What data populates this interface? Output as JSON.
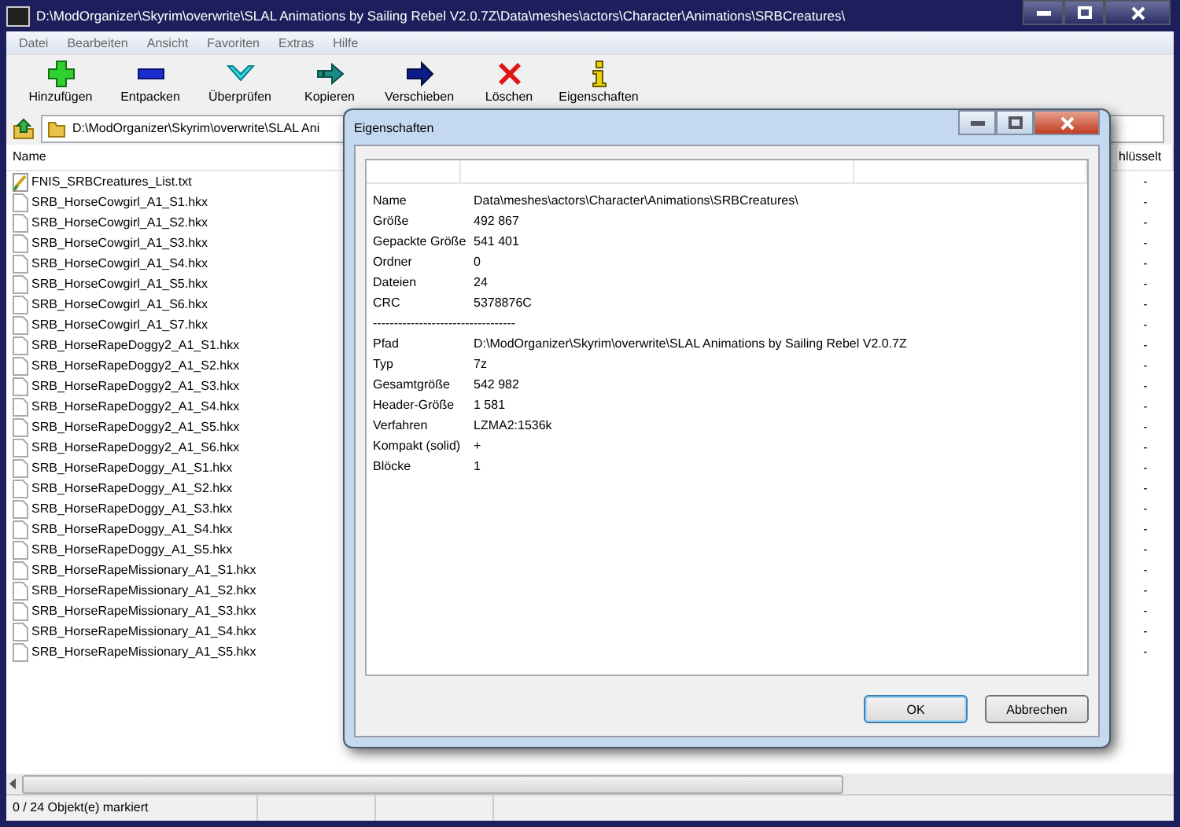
{
  "window": {
    "title": "D:\\ModOrganizer\\Skyrim\\overwrite\\SLAL Animations by Sailing Rebel V2.0.7Z\\Data\\meshes\\actors\\Character\\Animations\\SRBCreatures\\"
  },
  "menu": [
    "Datei",
    "Bearbeiten",
    "Ansicht",
    "Favoriten",
    "Extras",
    "Hilfe"
  ],
  "toolbar": [
    {
      "label": "Hinzufügen",
      "kind": "add"
    },
    {
      "label": "Entpacken",
      "kind": "extract"
    },
    {
      "label": "Überprüfen",
      "kind": "test"
    },
    {
      "label": "Kopieren",
      "kind": "copy"
    },
    {
      "label": "Verschieben",
      "kind": "move"
    },
    {
      "label": "Löschen",
      "kind": "delete"
    },
    {
      "label": "Eigenschaften",
      "kind": "info"
    }
  ],
  "address": "D:\\ModOrganizer\\Skyrim\\overwrite\\SLAL Ani",
  "list": {
    "columns": [
      "Name",
      "hlüsselt"
    ],
    "rows": [
      {
        "name": "FNIS_SRBCreatures_List.txt",
        "kind": "text",
        "column_2": "-"
      },
      {
        "name": "SRB_HorseCowgirl_A1_S1.hkx",
        "kind": "file",
        "column_2": "-"
      },
      {
        "name": "SRB_HorseCowgirl_A1_S2.hkx",
        "kind": "file",
        "column_2": "-"
      },
      {
        "name": "SRB_HorseCowgirl_A1_S3.hkx",
        "kind": "file",
        "column_2": "-"
      },
      {
        "name": "SRB_HorseCowgirl_A1_S4.hkx",
        "kind": "file",
        "column_2": "-"
      },
      {
        "name": "SRB_HorseCowgirl_A1_S5.hkx",
        "kind": "file",
        "column_2": "-"
      },
      {
        "name": "SRB_HorseCowgirl_A1_S6.hkx",
        "kind": "file",
        "column_2": "-"
      },
      {
        "name": "SRB_HorseCowgirl_A1_S7.hkx",
        "kind": "file",
        "column_2": "-"
      },
      {
        "name": "SRB_HorseRapeDoggy2_A1_S1.hkx",
        "kind": "file",
        "column_2": "-"
      },
      {
        "name": "SRB_HorseRapeDoggy2_A1_S2.hkx",
        "kind": "file",
        "column_2": "-"
      },
      {
        "name": "SRB_HorseRapeDoggy2_A1_S3.hkx",
        "kind": "file",
        "column_2": "-"
      },
      {
        "name": "SRB_HorseRapeDoggy2_A1_S4.hkx",
        "kind": "file",
        "column_2": "-"
      },
      {
        "name": "SRB_HorseRapeDoggy2_A1_S5.hkx",
        "kind": "file",
        "column_2": "-"
      },
      {
        "name": "SRB_HorseRapeDoggy2_A1_S6.hkx",
        "kind": "file",
        "column_2": "-"
      },
      {
        "name": "SRB_HorseRapeDoggy_A1_S1.hkx",
        "kind": "file",
        "column_2": "-"
      },
      {
        "name": "SRB_HorseRapeDoggy_A1_S2.hkx",
        "kind": "file",
        "column_2": "-"
      },
      {
        "name": "SRB_HorseRapeDoggy_A1_S3.hkx",
        "kind": "file",
        "column_2": "-"
      },
      {
        "name": "SRB_HorseRapeDoggy_A1_S4.hkx",
        "kind": "file",
        "column_2": "-"
      },
      {
        "name": "SRB_HorseRapeDoggy_A1_S5.hkx",
        "kind": "file",
        "column_2": "-"
      },
      {
        "name": "SRB_HorseRapeMissionary_A1_S1.hkx",
        "kind": "file",
        "column_2": "-"
      },
      {
        "name": "SRB_HorseRapeMissionary_A1_S2.hkx",
        "kind": "file",
        "column_2": "-"
      },
      {
        "name": "SRB_HorseRapeMissionary_A1_S3.hkx",
        "kind": "file",
        "column_2": "-"
      },
      {
        "name": "SRB_HorseRapeMissionary_A1_S4.hkx",
        "kind": "file",
        "column_2": "-"
      },
      {
        "name": "SRB_HorseRapeMissionary_A1_S5.hkx",
        "kind": "file",
        "column_2": "-"
      }
    ]
  },
  "dialog": {
    "title": "Eigenschaften",
    "properties": [
      {
        "kind": "pair",
        "label": "Name",
        "value": "Data\\meshes\\actors\\Character\\Animations\\SRBCreatures\\"
      },
      {
        "kind": "pair",
        "label": "Größe",
        "value": "492 867"
      },
      {
        "kind": "pair",
        "label": "Gepackte Größe",
        "value": "541 401"
      },
      {
        "kind": "pair",
        "label": "Ordner",
        "value": "0"
      },
      {
        "kind": "pair",
        "label": "Dateien",
        "value": "24"
      },
      {
        "kind": "pair",
        "label": "CRC",
        "value": "5378876C"
      },
      {
        "kind": "separator",
        "label": "----------------------------------"
      },
      {
        "kind": "pair",
        "label": "Pfad",
        "value": "D:\\ModOrganizer\\Skyrim\\overwrite\\SLAL Animations by Sailing Rebel V2.0.7Z"
      },
      {
        "kind": "pair",
        "label": "Typ",
        "value": "7z"
      },
      {
        "kind": "pair",
        "label": "Gesamtgröße",
        "value": "542 982"
      },
      {
        "kind": "pair",
        "label": "Header-Größe",
        "value": "1 581"
      },
      {
        "kind": "pair",
        "label": "Verfahren",
        "value": "LZMA2:1536k"
      },
      {
        "kind": "pair",
        "label": "Kompakt (solid)",
        "value": "+"
      },
      {
        "kind": "pair",
        "label": "Blöcke",
        "value": "1"
      }
    ],
    "buttons": [
      {
        "label": "OK",
        "default": true
      },
      {
        "label": "Abbrechen",
        "default": false
      }
    ]
  },
  "status_bar": [
    "0 / 24 Objekt(e) markiert"
  ]
}
